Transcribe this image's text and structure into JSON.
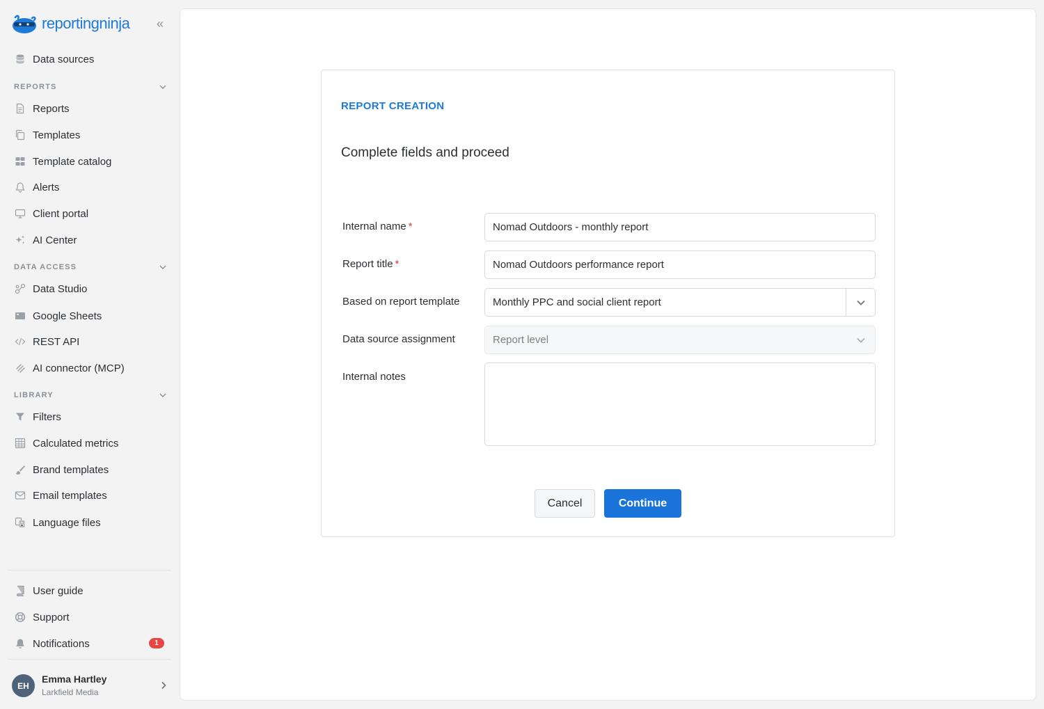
{
  "app": {
    "logo_text": "reportingninja"
  },
  "sidebar": {
    "top_items": [
      {
        "label": "Data sources",
        "icon": "database-icon"
      }
    ],
    "sections": {
      "reports": {
        "header": "REPORTS",
        "items": [
          {
            "label": "Reports",
            "icon": "document-icon"
          },
          {
            "label": "Templates",
            "icon": "copy-icon"
          },
          {
            "label": "Template catalog",
            "icon": "grid-icon"
          },
          {
            "label": "Alerts",
            "icon": "bell-icon"
          },
          {
            "label": "Client portal",
            "icon": "monitor-icon"
          },
          {
            "label": "AI Center",
            "icon": "sparkle-icon"
          }
        ]
      },
      "data_access": {
        "header": "DATA ACCESS",
        "items": [
          {
            "label": "Data Studio",
            "icon": "nodes-icon"
          },
          {
            "label": "Google Sheets",
            "icon": "sheet-icon"
          },
          {
            "label": "REST API",
            "icon": "code-icon"
          },
          {
            "label": "AI connector (MCP)",
            "icon": "connector-icon"
          }
        ]
      },
      "library": {
        "header": "LIBRARY",
        "items": [
          {
            "label": "Filters",
            "icon": "filter-icon"
          },
          {
            "label": "Calculated metrics",
            "icon": "table-icon"
          },
          {
            "label": "Brand templates",
            "icon": "brush-icon"
          },
          {
            "label": "Email templates",
            "icon": "mail-icon"
          },
          {
            "label": "Language files",
            "icon": "language-icon"
          }
        ]
      }
    },
    "bottom_items": [
      {
        "label": "User guide",
        "icon": "book-icon"
      },
      {
        "label": "Support",
        "icon": "lifebuoy-icon"
      },
      {
        "label": "Notifications",
        "icon": "bell-filled-icon",
        "badge": "1"
      }
    ],
    "user": {
      "initials": "EH",
      "name": "Emma Hartley",
      "org": "Larkfield Media"
    }
  },
  "form": {
    "eyebrow": "REPORT CREATION",
    "subtitle": "Complete fields and proceed",
    "fields": {
      "internal_name": {
        "label": "Internal name",
        "required_mark": "*",
        "value": "Nomad Outdoors - monthly report"
      },
      "report_title": {
        "label": "Report title",
        "required_mark": "*",
        "value": "Nomad Outdoors performance report"
      },
      "template": {
        "label": "Based on report template",
        "value": "Monthly PPC and social client report"
      },
      "data_source_assignment": {
        "label": "Data source assignment",
        "value": "Report level",
        "disabled": true
      },
      "internal_notes": {
        "label": "Internal notes",
        "value": ""
      }
    },
    "buttons": {
      "cancel": "Cancel",
      "continue": "Continue"
    }
  },
  "colors": {
    "accent": "#1a74d9",
    "badge": "#e84545",
    "required": "#e03a3a"
  }
}
